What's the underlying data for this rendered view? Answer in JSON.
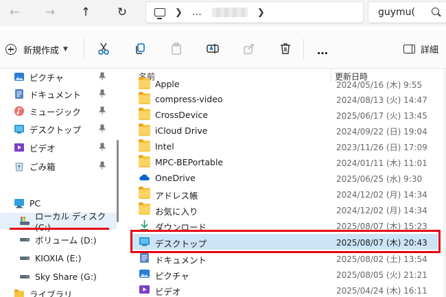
{
  "address": {
    "more": "…",
    "search_text": "guymu("
  },
  "toolbar": {
    "new_label": "新規作成",
    "detail_label": "詳細",
    "more": "…"
  },
  "sidebar": {
    "quick": [
      {
        "label": "ピクチャ",
        "icon": "pictures-icon",
        "pinned": true
      },
      {
        "label": "ドキュメント",
        "icon": "documents-icon",
        "pinned": true
      },
      {
        "label": "ミュージック",
        "icon": "music-icon",
        "pinned": true
      },
      {
        "label": "デスクトップ",
        "icon": "desktop-icon",
        "pinned": true
      },
      {
        "label": "ビデオ",
        "icon": "videos-icon",
        "pinned": true
      },
      {
        "label": "ごみ箱",
        "icon": "recycle-bin-icon",
        "pinned": true
      }
    ],
    "drives": [
      {
        "label": "PC",
        "icon": "pc-icon"
      },
      {
        "label": "ローカル ディスク (C:)",
        "icon": "local-disk-icon",
        "selected": true
      },
      {
        "label": "ボリューム (D:)",
        "icon": "drive-icon"
      },
      {
        "label": "KIOXIA (E:)",
        "icon": "drive-icon"
      },
      {
        "label": "Sky Share (G:)",
        "icon": "drive-icon"
      },
      {
        "label": "ライブラリ",
        "icon": "library-icon"
      }
    ]
  },
  "list": {
    "col_name": "名前",
    "col_date": "更新日時",
    "rows": [
      {
        "name": "Apple",
        "date": "2024/05/16 (木) 9:55",
        "icon": "folder-icon"
      },
      {
        "name": "compress-video",
        "date": "2024/08/13 (火) 14:47",
        "icon": "folder-icon"
      },
      {
        "name": "CrossDevice",
        "date": "2025/06/17 (火) 13:45",
        "icon": "folder-icon"
      },
      {
        "name": "iCloud Drive",
        "date": "2024/09/22 (日) 19:04",
        "icon": "folder-icon"
      },
      {
        "name": "Intel",
        "date": "2023/11/26 (日) 17:09",
        "icon": "folder-icon"
      },
      {
        "name": "MPC-BEPortable",
        "date": "2024/01/11 (木) 11:01",
        "icon": "folder-icon"
      },
      {
        "name": "OneDrive",
        "date": "2025/06/25 (水) 9:30",
        "icon": "onedrive-icon"
      },
      {
        "name": "アドレス帳",
        "date": "2024/12/02 (月) 14:34",
        "icon": "folder-icon"
      },
      {
        "name": "お気に入り",
        "date": "2024/12/02 (月) 14:34",
        "icon": "folder-icon"
      },
      {
        "name": "ダウンロード",
        "date": "2025/08/07 (木) 15:23",
        "icon": "downloads-icon"
      },
      {
        "name": "デスクトップ",
        "date": "2025/08/07 (木) 20:43",
        "icon": "desktop-icon",
        "selected": true
      },
      {
        "name": "ドキュメント",
        "date": "2025/08/02 (土) 13:54",
        "icon": "documents-icon"
      },
      {
        "name": "ピクチャ",
        "date": "2025/08/05 (火) 21:21",
        "icon": "pictures-icon"
      },
      {
        "name": "ビデオ",
        "date": "2025/04/24 (木) 16:11",
        "icon": "videos-icon"
      }
    ]
  },
  "colors": {
    "accent": "#0067c0",
    "selection": "#cce4f7",
    "highlight_red": "#e60012",
    "folder": "#f9c440"
  }
}
